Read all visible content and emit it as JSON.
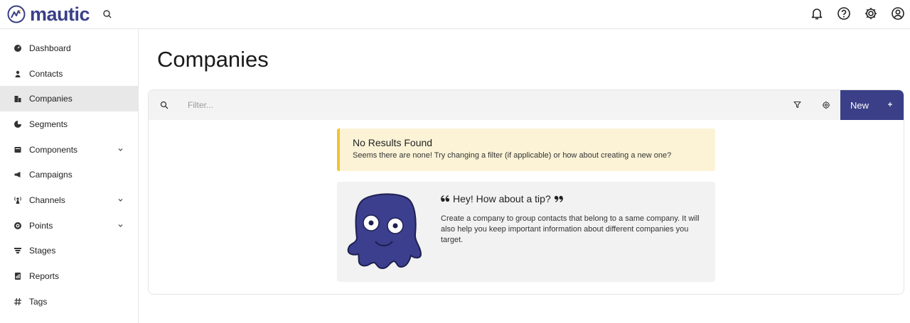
{
  "app": {
    "brand_name": "mautic",
    "brand_color": "#3a3f87"
  },
  "topbar": {
    "icons": [
      "search-icon",
      "bell-icon",
      "help-icon",
      "settings-icon",
      "user-icon"
    ]
  },
  "sidebar": {
    "items": [
      {
        "label": "Dashboard",
        "icon": "dashboard-icon",
        "active": false,
        "has_submenu": false
      },
      {
        "label": "Contacts",
        "icon": "person-icon",
        "active": false,
        "has_submenu": false
      },
      {
        "label": "Companies",
        "icon": "building-icon",
        "active": true,
        "has_submenu": false
      },
      {
        "label": "Segments",
        "icon": "pie-icon",
        "active": false,
        "has_submenu": false
      },
      {
        "label": "Components",
        "icon": "component-icon",
        "active": false,
        "has_submenu": true
      },
      {
        "label": "Campaigns",
        "icon": "megaphone-icon",
        "active": false,
        "has_submenu": false
      },
      {
        "label": "Channels",
        "icon": "broadcast-icon",
        "active": false,
        "has_submenu": true
      },
      {
        "label": "Points",
        "icon": "target-icon",
        "active": false,
        "has_submenu": true
      },
      {
        "label": "Stages",
        "icon": "funnel-icon",
        "active": false,
        "has_submenu": false
      },
      {
        "label": "Reports",
        "icon": "report-icon",
        "active": false,
        "has_submenu": false
      },
      {
        "label": "Tags",
        "icon": "hash-icon",
        "active": false,
        "has_submenu": false
      }
    ]
  },
  "main": {
    "title": "Companies",
    "filter": {
      "placeholder": "Filter...",
      "value": ""
    },
    "new_button_label": "New",
    "alert": {
      "title": "No Results Found",
      "text": "Seems there are none! Try changing a filter (if applicable) or how about creating a new one?"
    },
    "tip": {
      "heading": "Hey! How about a tip?",
      "body": "Create a company to group contacts that belong to a same company. It will also help you keep important information about different companies you target."
    }
  }
}
